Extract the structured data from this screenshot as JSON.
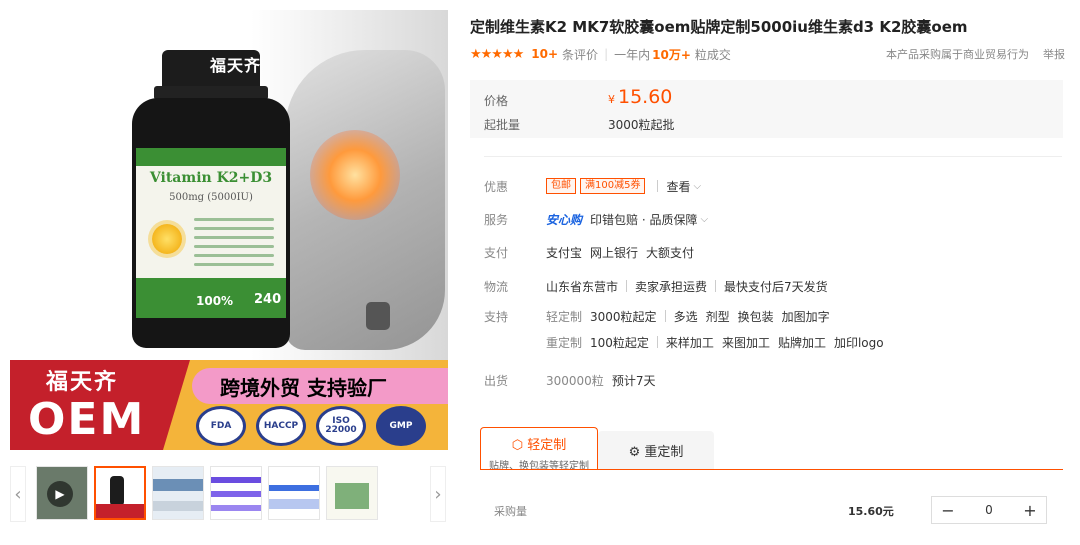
{
  "gallery": {
    "bottle_brand": "福天齐",
    "label_title": "Vitamin K2+D3",
    "label_sub": "500mg (5000IU)",
    "label_pct": "100%",
    "label_count": "240",
    "banner_brand": "福天齐",
    "banner_oem": "OEM",
    "banner_slogan": "跨境外贸 支持验厂",
    "badges": [
      "FDA",
      "HACCP",
      "ISO 22000",
      "GMP"
    ],
    "thumb_count": 6
  },
  "product": {
    "title": "定制维生素K2 MK7软胶囊oem贴牌定制5000iu维生素d3 K2胶囊oem",
    "stars": "★★★★★",
    "reviews_count": "10+",
    "reviews_label": "条评价",
    "sales_prefix": "一年内",
    "sales_count": "10万+",
    "sales_suffix": "粒成交",
    "trade_note": "本产品采购属于商业贸易行为",
    "report": "举报"
  },
  "price": {
    "price_label": "价格",
    "currency": "¥",
    "price": "15.60",
    "moq_label": "起批量",
    "moq": "3000粒起批"
  },
  "attributes": {
    "promo_label": "优惠",
    "promo_tags": [
      "包邮",
      "满100减5券"
    ],
    "promo_more": "查看",
    "service_label": "服务",
    "service_brand": "安心购",
    "service_text": "印错包赔 · 品质保障",
    "pay_label": "支付",
    "pay_methods": [
      "支付宝",
      "网上银行",
      "大额支付"
    ],
    "logistics_label": "物流",
    "logistics_items": [
      "山东省东营市",
      "卖家承担运费",
      "最快支付后7天发货"
    ],
    "support_label": "支持",
    "support_light_title": "轻定制",
    "support_light": [
      "3000粒起定",
      "多选",
      "剂型",
      "换包装",
      "加图加字"
    ],
    "support_heavy_title": "重定制",
    "support_heavy": [
      "100粒起定",
      "来样加工",
      "来图加工",
      "贴牌加工",
      "加印logo"
    ],
    "ship_label": "出货",
    "ship_qty": "300000粒",
    "ship_eta": "预计7天"
  },
  "custom_tabs": {
    "light_title": "轻定制",
    "light_note": "贴牌、换包装等轻定制",
    "heavy_title": "重定制"
  },
  "quantity": {
    "label": "采购量",
    "unit_price": "15.60元",
    "value": "0",
    "minus": "−",
    "plus": "+"
  }
}
